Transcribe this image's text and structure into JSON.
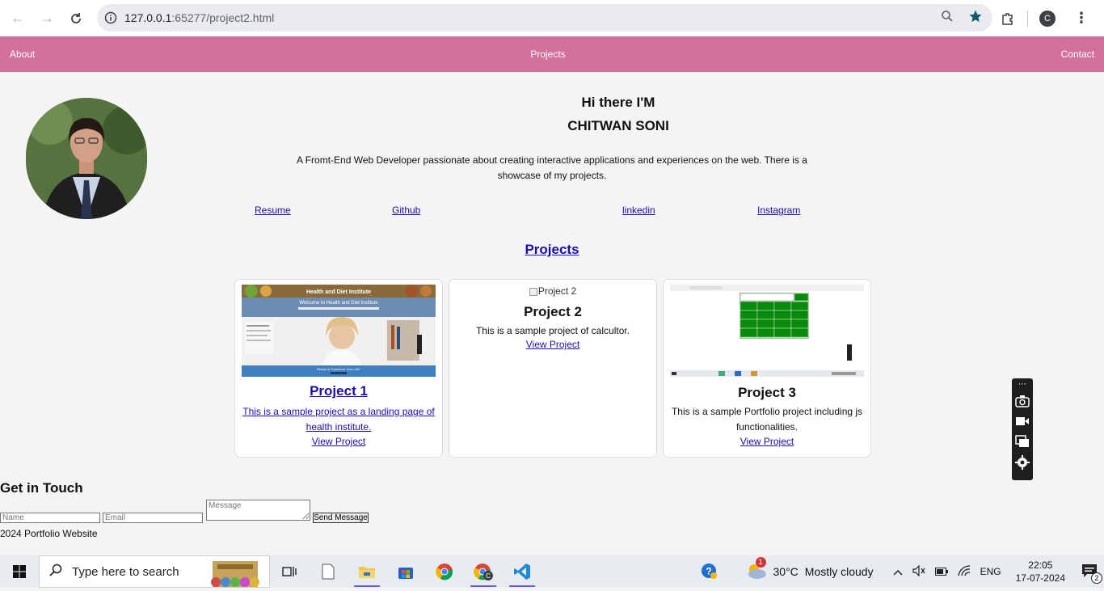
{
  "browser": {
    "url_host": "127.0.0.1",
    "url_rest": ":65277/project2.html",
    "profile_initial": "C"
  },
  "nav": {
    "about": "About",
    "projects": "Projects",
    "contact": "Contact"
  },
  "hero": {
    "greeting": "Hi there I'M",
    "name": "CHITWAN SONI",
    "description": "A Fromt-End Web Developer passionate about creating interactive applications and experiences on the web. There is a showcase of my projects."
  },
  "social": {
    "resume": "Resume",
    "github": "Github",
    "linkedin": "linkedin",
    "instagram": "Instagram"
  },
  "projects": {
    "heading": "Projects",
    "cards": [
      {
        "title": "Project 1",
        "description": "This is a sample project as a landing page of health institute.",
        "link": "View Project",
        "thumb_header": "Health and Diet Institute",
        "thumb_welcome": "Welcome to Health and Diet Institute",
        "thumb_banner": "Ready to Transform Your Life?"
      },
      {
        "title": "Project 2",
        "image_alt": "Project 2",
        "description": "This is a sample project of calcultor.",
        "link": "View Project"
      },
      {
        "title": "Project 3",
        "description": "This is a sample Portfolio project including js functionalities.",
        "link": "View Project"
      }
    ]
  },
  "contact": {
    "heading": "Get in Touch",
    "name_placeholder": "Name",
    "email_placeholder": "Email",
    "message_placeholder": "Message",
    "send_label": "Send Message"
  },
  "footer": {
    "text": "2024 Portfolio Website"
  },
  "taskbar": {
    "search_placeholder": "Type here to search",
    "weather_temp": "30°C",
    "weather_desc": "Mostly cloudy",
    "weather_badge": "1",
    "lang": "ENG",
    "time": "22:05",
    "date": "17-07-2024",
    "notif_count": "2"
  },
  "colors": {
    "nav_bg": "#d3709b",
    "link": "#1a0dab",
    "calc_green": "#0a8a0a"
  }
}
